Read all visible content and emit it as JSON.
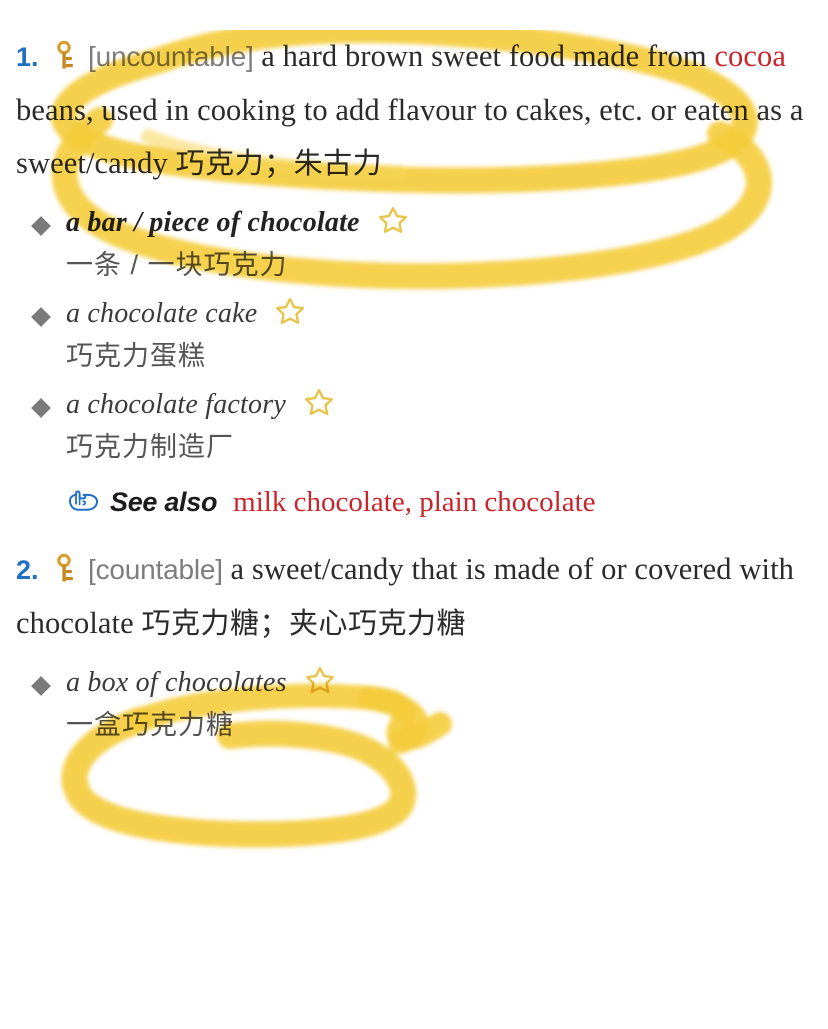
{
  "page": {
    "background": "#ffffff",
    "highlight_color": "#f6cf3f",
    "accent_blue": "#1f6fc4",
    "xref_red": "#c8252c",
    "gram_gray": "#7d7d7d",
    "star_gold": "#e8c44a"
  },
  "senses": [
    {
      "number": "1.",
      "key_icon": "key-icon",
      "grammar_label": "[uncountable]",
      "definition_en": "a hard brown sweet food made from ",
      "xref_inline": "cocoa",
      "definition_en_cont": " beans, used in cooking to add flavour to cakes, etc. or eaten as a sweet/candy ",
      "definition_cn": "巧克力；朱古力",
      "examples": [
        {
          "en": "a bar / piece of chocolate",
          "cn": "一条 / 一块巧克力",
          "bold": true,
          "star_icon": "star-icon"
        },
        {
          "en": "a chocolate cake",
          "cn": "巧克力蛋糕",
          "bold": false,
          "star_icon": "star-icon"
        },
        {
          "en": "a chocolate factory",
          "cn": "巧克力制造厂",
          "bold": false,
          "star_icon": "star-icon"
        }
      ],
      "see_also": {
        "hand_icon": "pointing-hand-icon",
        "label": "See also",
        "links": "milk chocolate, plain chocolate"
      }
    },
    {
      "number": "2.",
      "key_icon": "key-icon",
      "grammar_label": "[countable]",
      "definition_en": "a sweet/candy that is made of or covered with chocolate ",
      "definition_cn": "巧克力糖；夹心巧克力糖",
      "examples": [
        {
          "en": "a box of chocolates",
          "cn": "一盒巧克力糖",
          "bold": false,
          "star_icon": "star-icon"
        }
      ]
    }
  ]
}
